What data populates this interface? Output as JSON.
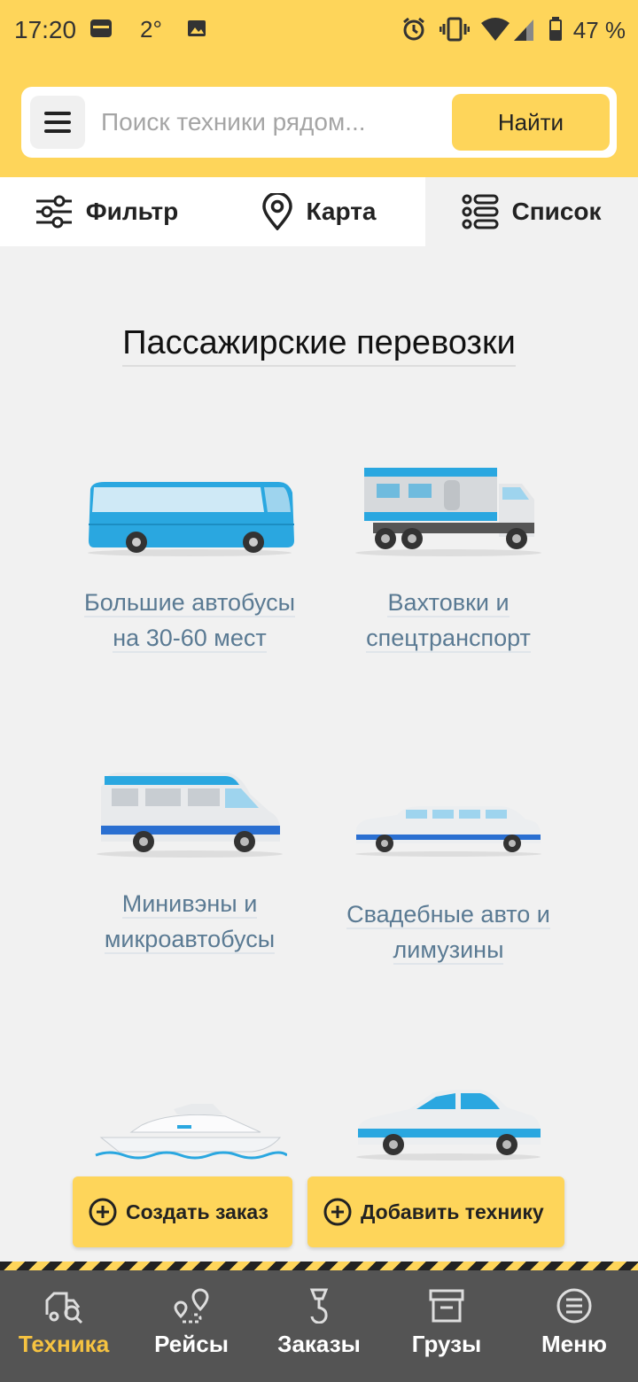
{
  "status_bar": {
    "time": "17:20",
    "temperature": "2°",
    "battery": "47 %"
  },
  "search": {
    "placeholder": "Поиск техники рядом...",
    "button_label": "Найти"
  },
  "tabs": [
    {
      "label": "Фильтр",
      "icon": "sliders-icon"
    },
    {
      "label": "Карта",
      "icon": "map-pin-icon"
    },
    {
      "label": "Список",
      "icon": "list-icon",
      "active": true
    }
  ],
  "section": {
    "title": "Пассажирские перевозки"
  },
  "categories": [
    {
      "label_line1": "Большие автобусы",
      "label_line2": "на 30-60 мест",
      "icon": "bus-icon"
    },
    {
      "label_line1": "Вахтовки и",
      "label_line2": "спецтранспорт",
      "icon": "shift-truck-icon"
    },
    {
      "label_line1": "Минивэны и",
      "label_line2": "микроавтобусы",
      "icon": "minibus-icon"
    },
    {
      "label_line1": "Свадебные авто и",
      "label_line2": "лимузины",
      "icon": "limousine-icon"
    },
    {
      "icon": "yacht-icon"
    },
    {
      "icon": "sedan-car-icon"
    }
  ],
  "actions": {
    "create_order": "Создать заказ",
    "add_equipment": "Добавить технику"
  },
  "bottom_nav": [
    {
      "label": "Техника",
      "icon": "truck-search-icon",
      "active": true
    },
    {
      "label": "Рейсы",
      "icon": "route-icon"
    },
    {
      "label": "Заказы",
      "icon": "crane-hook-icon"
    },
    {
      "label": "Грузы",
      "icon": "cargo-box-icon"
    },
    {
      "label": "Меню",
      "icon": "menu-circle-icon"
    }
  ],
  "colors": {
    "accent_yellow": "#fed55a",
    "nav_background": "#545454",
    "nav_active": "#f6c341",
    "category_text": "#5a7a93",
    "vehicle_blue": "#2aa7e0"
  }
}
